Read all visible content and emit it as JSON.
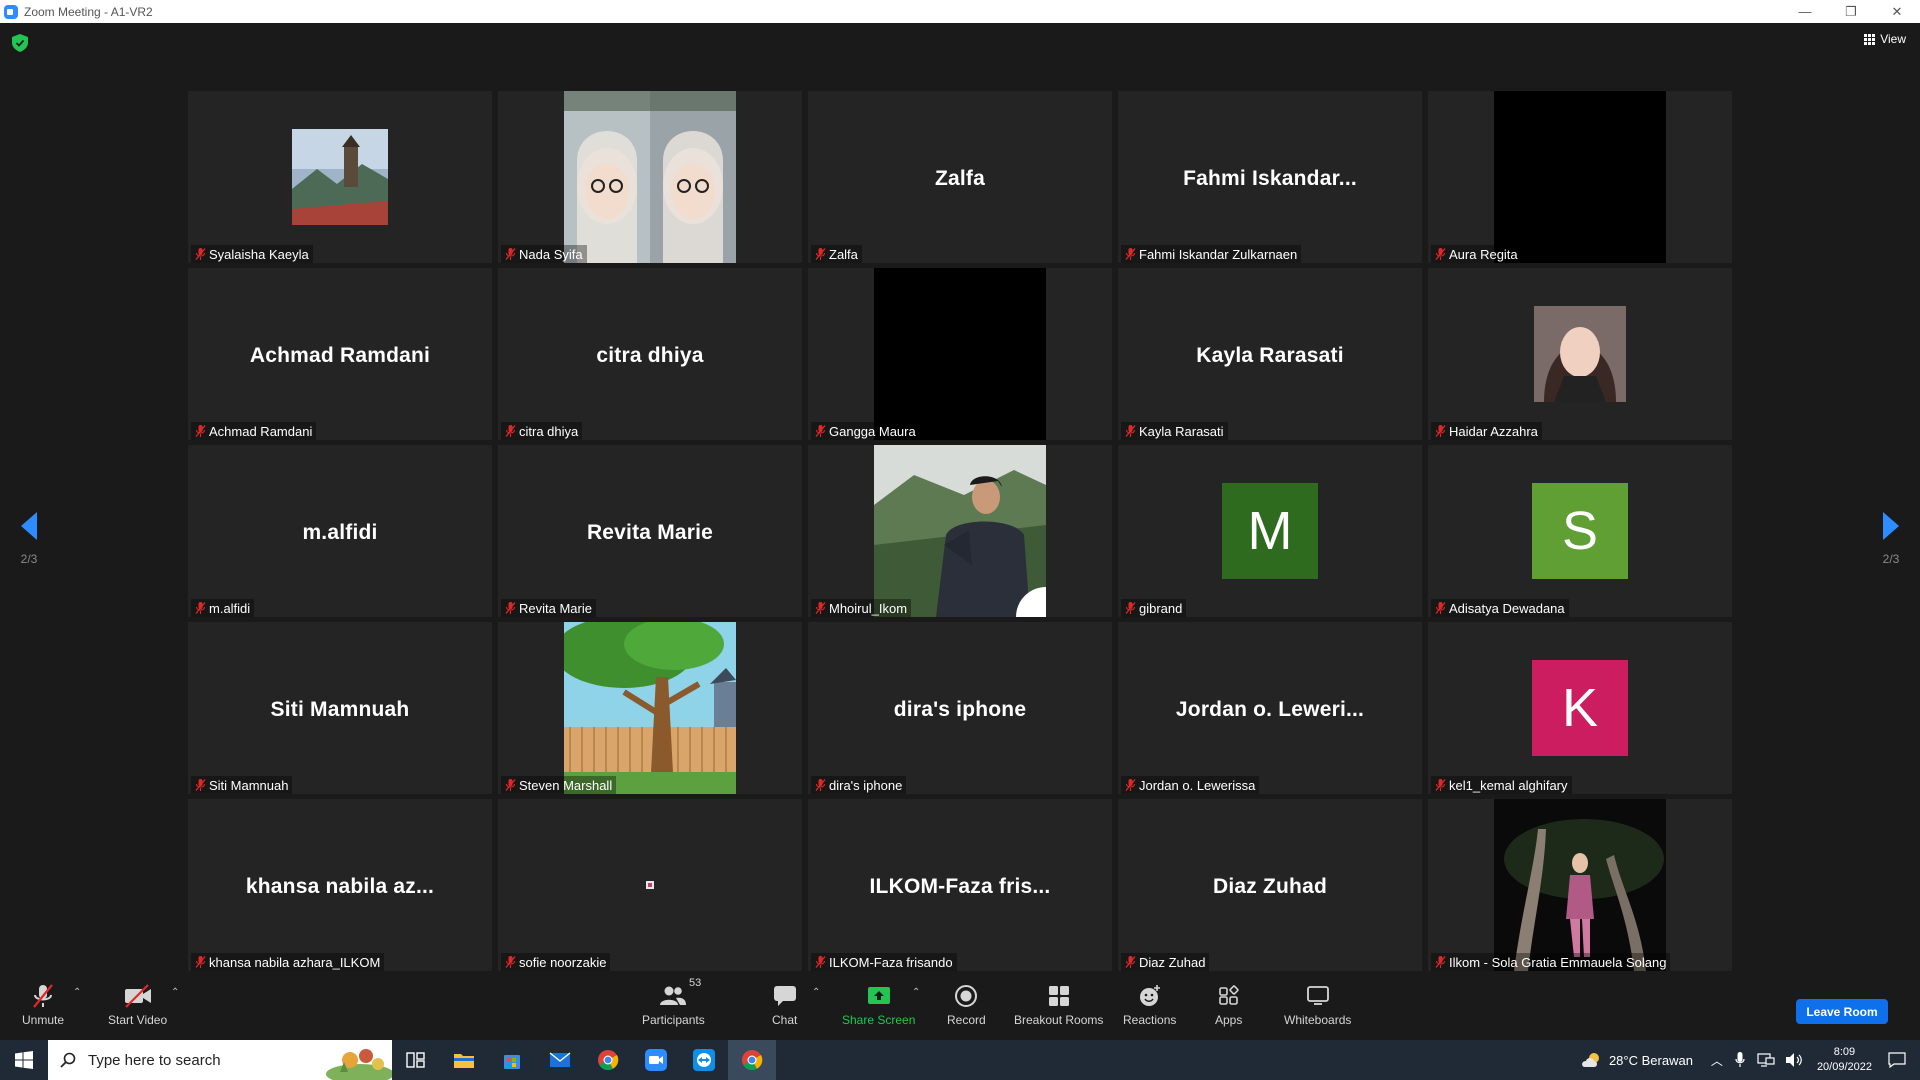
{
  "window": {
    "title": "Zoom Meeting - A1-VR2",
    "minimize": "—",
    "restore": "❐",
    "close": "✕"
  },
  "meeting": {
    "view_label": "View",
    "page_left": "2/3",
    "page_right": "2/3"
  },
  "tiles": [
    {
      "label": "Syalaisha Kaeyla",
      "display": "",
      "kind": "photo-small"
    },
    {
      "label": "Nada Syifa",
      "display": "",
      "kind": "video"
    },
    {
      "label": "Zalfa",
      "display": "Zalfa",
      "kind": "name"
    },
    {
      "label": "Fahmi Iskandar Zulkarnaen",
      "display": "Fahmi  Iskandar...",
      "kind": "name"
    },
    {
      "label": "Aura Regita",
      "display": "",
      "kind": "black"
    },
    {
      "label": "Achmad Ramdani",
      "display": "Achmad Ramdani",
      "kind": "name"
    },
    {
      "label": "citra dhiya",
      "display": "citra dhiya",
      "kind": "name"
    },
    {
      "label": "Gangga Maura",
      "display": "",
      "kind": "black"
    },
    {
      "label": "Kayla Rarasati",
      "display": "Kayla Rarasati",
      "kind": "name"
    },
    {
      "label": "Haidar Azzahra",
      "display": "",
      "kind": "photo-portrait"
    },
    {
      "label": "m.alfidi",
      "display": "m.alfidi",
      "kind": "name"
    },
    {
      "label": "Revita Marie",
      "display": "Revita Marie",
      "kind": "name"
    },
    {
      "label": "Mhoirul_Ikom",
      "display": "",
      "kind": "video-person"
    },
    {
      "label": "gibrand",
      "display": "M",
      "kind": "letter",
      "color": "#2e6b1f"
    },
    {
      "label": "Adisatya Dewadana",
      "display": "S",
      "kind": "letter",
      "color": "#5f9f33"
    },
    {
      "label": "Siti Mamnuah",
      "display": "Siti Mamnuah",
      "kind": "name"
    },
    {
      "label": "Steven Marshall",
      "display": "",
      "kind": "cartoon"
    },
    {
      "label": "dira's iphone",
      "display": "dira's iphone",
      "kind": "name"
    },
    {
      "label": "Jordan o. Lewerissa",
      "display": "Jordan  o.  Leweri...",
      "kind": "name"
    },
    {
      "label": "kel1_kemal alghifary",
      "display": "K",
      "kind": "letter",
      "color": "#cc1d60"
    },
    {
      "label": "khansa nabila azhara_ILKOM",
      "display": "khansa  nabila  az...",
      "kind": "name"
    },
    {
      "label": "sofie noorzakie",
      "display": "",
      "kind": "tiny"
    },
    {
      "label": "ILKOM-Faza frisando",
      "display": "ILKOM-Faza  fris...",
      "kind": "name"
    },
    {
      "label": "Diaz Zuhad",
      "display": "Diaz Zuhad",
      "kind": "name"
    },
    {
      "label": "Ilkom - Sola Gratia Emmauela Solang",
      "display": "",
      "kind": "night-photo"
    }
  ],
  "toolbar": {
    "unmute": "Unmute",
    "start_video": "Start Video",
    "participants": "Participants",
    "participants_count": "53",
    "chat": "Chat",
    "share_screen": "Share Screen",
    "record": "Record",
    "breakout_rooms": "Breakout Rooms",
    "reactions": "Reactions",
    "apps": "Apps",
    "whiteboards": "Whiteboards",
    "leave_room": "Leave Room",
    "caret": "⌃"
  },
  "taskbar": {
    "search_placeholder": "Type here to search",
    "weather": "28°C  Berawan",
    "time": "8:09",
    "date": "20/09/2022"
  },
  "colors": {
    "share_green": "#23c552",
    "leave_blue": "#0e71eb",
    "nav_arrow": "#2d8cff",
    "mute_red": "#e02828"
  }
}
